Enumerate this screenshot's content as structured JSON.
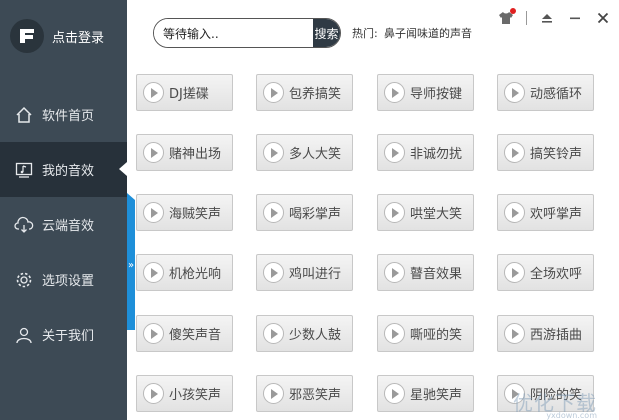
{
  "sidebar": {
    "login_label": "点击登录",
    "items": [
      {
        "label": "软件首页",
        "icon": "home-icon"
      },
      {
        "label": "我的音效",
        "icon": "music-icon"
      },
      {
        "label": "云端音效",
        "icon": "cloud-icon"
      },
      {
        "label": "选项设置",
        "icon": "gear-icon"
      },
      {
        "label": "关于我们",
        "icon": "user-icon"
      }
    ],
    "active_index": 1,
    "handle_label": "»"
  },
  "header": {
    "search_value": "等待输入..",
    "search_button": "搜索",
    "hot_label": "热门:",
    "hot_text": "鼻子闻味道的声音"
  },
  "effects": [
    [
      "DJ搓碟",
      "包养搞笑",
      "导师按键",
      "动感循环"
    ],
    [
      "赌神出场",
      "多人大笑",
      "非诚勿扰",
      "搞笑铃声"
    ],
    [
      "海贼笑声",
      "喝彩掌声",
      "哄堂大笑",
      "欢呼掌声"
    ],
    [
      "机枪光响",
      "鸡叫进行",
      "瞽音效果",
      "全场欢呼"
    ],
    [
      "傻笑声音",
      "少数人鼓",
      "嘶哑的笑",
      "西游插曲"
    ],
    [
      "小孩笑声",
      "邪恶笑声",
      "星驰笑声",
      "阴险的笑"
    ]
  ],
  "watermark": {
    "text": "优化下载",
    "sub": "yxdown.com"
  },
  "colors": {
    "sidebar": "#3d4a55",
    "active": "#27313a",
    "accent": "#1e8fd9"
  }
}
